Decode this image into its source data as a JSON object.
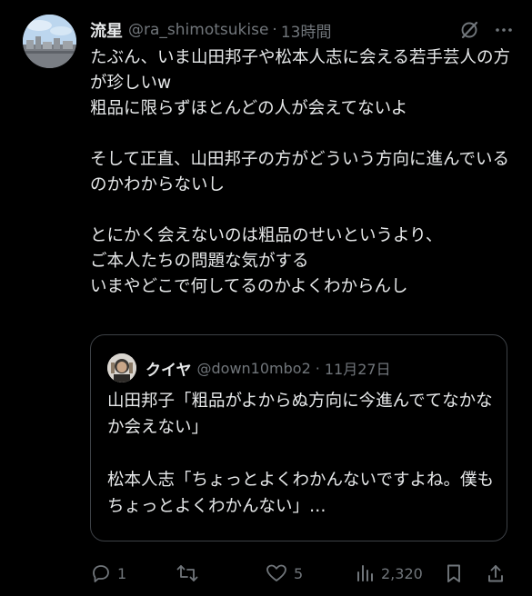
{
  "tweet": {
    "display_name": "流星",
    "handle": "@ra_shimotsukise",
    "separator": "·",
    "time": "13時間",
    "paragraphs": [
      "たぶん、いま山田邦子や松本人志に会える若手芸人の方が珍しいw\n粗品に限らずほとんどの人が会えてないよ",
      "そして正直、山田邦子の方がどういう方向に進んでいるのかわからないし",
      "とにかく会えないのは粗品のせいというより、\nご本人たちの問題な気がする\nいまやどこで何してるのかよくわからんし"
    ],
    "header_icons": [
      "grok-icon",
      "more-icon"
    ]
  },
  "quote": {
    "display_name": "クイヤ",
    "handle": "@down10mbo2",
    "separator": "·",
    "date": "11月27日",
    "paragraphs": [
      "山田邦子「粗品がよからぬ方向に今進んでてなかなか会えない」",
      "松本人志「ちょっとよくわかんないですよね。僕もちょっとよくわかんない」…"
    ]
  },
  "actions": {
    "reply_count": "1",
    "retweet_count": "",
    "like_count": "5",
    "views_count": "2,320"
  },
  "colors": {
    "background": "#000000",
    "text": "#e7e9ea",
    "muted": "#71767b",
    "border": "#3d4146"
  }
}
